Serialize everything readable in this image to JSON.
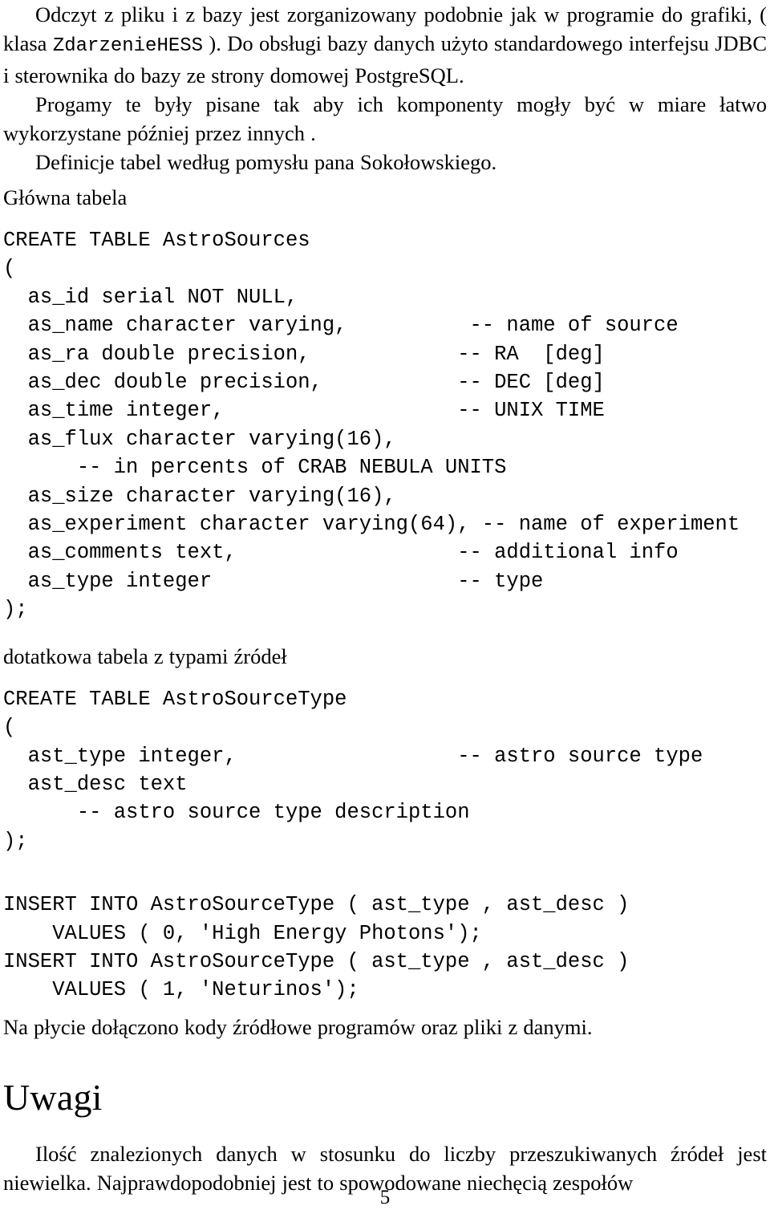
{
  "document": {
    "language": "pl",
    "page_number": "5"
  },
  "paragraphs": {
    "p1_before_mono": "Odczyt z pliku i z bazy jest zorganizowany podobnie jak w programie do grafiki, ( klasa ",
    "p1_mono": "ZdarzenieHESS",
    "p1_after_mono": " ). Do obsługi bazy danych użyto standardo­wego interfejsu JDBC i sterownika do bazy ze strony domowej PostgreSQL.",
    "p2": "Progamy te były pisane tak aby ich komponenty mogły być w miare łatwo wykorzystane później przez innych .",
    "p3": "Definicje tabel według pomysłu pana Sokołowskiego.",
    "caption_main_table": "Główna tabela",
    "caption_extra_table": "dotatkowa tabela z typami źródeł",
    "p_after_inserts": "Na płycie dołączono kody źródłowe programów oraz pliki z danymi.",
    "p_uwagi_body": "Ilość znalezionych danych w stosunku do liczby przeszukiwanych źródeł jest niewielka. Najprawdopodobniej jest to spowodowane niechęcią zespołów"
  },
  "headings": {
    "uwagi": "Uwagi"
  },
  "code_blocks": {
    "create_astrosources": "CREATE TABLE AstroSources\n(\n  as_id serial NOT NULL,\n  as_name character varying,          -- name of source\n  as_ra double precision,            -- RA  [deg]\n  as_dec double precision,           -- DEC [deg]\n  as_time integer,                   -- UNIX TIME\n  as_flux character varying(16),\n      -- in percents of CRAB NEBULA UNITS\n  as_size character varying(16),\n  as_experiment character varying(64), -- name of experiment\n  as_comments text,                  -- additional info\n  as_type integer                    -- type\n);",
    "create_astrosourcetype": "CREATE TABLE AstroSourceType\n(\n  ast_type integer,                  -- astro source type\n  ast_desc text\n      -- astro source type description\n);",
    "inserts": "INSERT INTO AstroSourceType ( ast_type , ast_desc )\n    VALUES ( 0, 'High Energy Photons');\nINSERT INTO AstroSourceType ( ast_type , ast_desc )\n    VALUES ( 1, 'Neturinos');"
  },
  "colors": {
    "text": "#000000",
    "background": "#ffffff"
  }
}
